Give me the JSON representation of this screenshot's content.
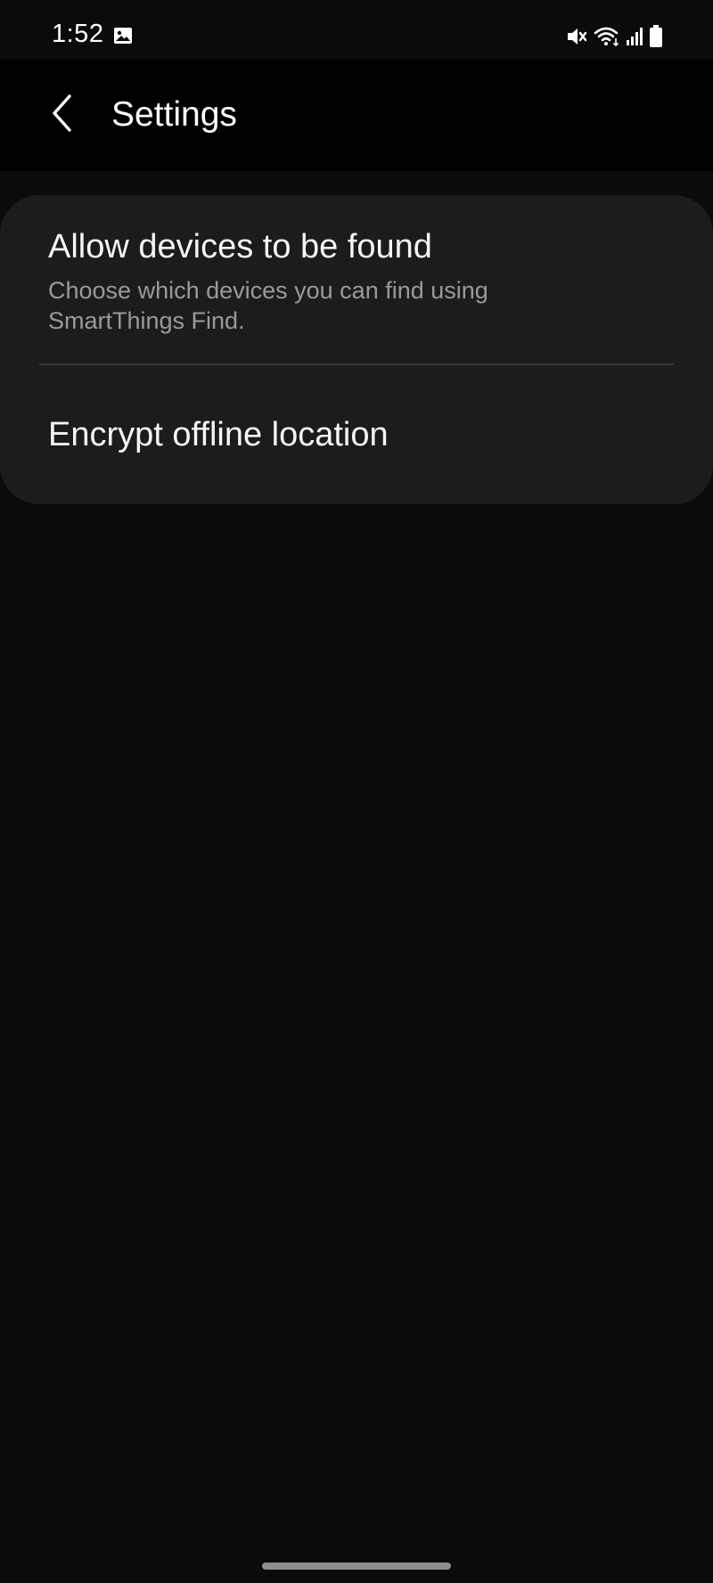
{
  "status_bar": {
    "time": "1:52",
    "icons": [
      "gallery-icon",
      "mute-icon",
      "wifi-icon",
      "signal-icon",
      "battery-icon"
    ]
  },
  "header": {
    "back_icon": "chevron-left-icon",
    "title": "Settings"
  },
  "settings": {
    "items": [
      {
        "title": "Allow devices to be found",
        "subtitle": "Choose which devices you can find using SmartThings Find."
      },
      {
        "title": "Encrypt offline location"
      }
    ]
  },
  "colors": {
    "background": "#0b0b0b",
    "app_bar": "#000000",
    "card": "#1c1c1c",
    "subtitle_text": "#9a9a9a",
    "divider": "#363636"
  }
}
